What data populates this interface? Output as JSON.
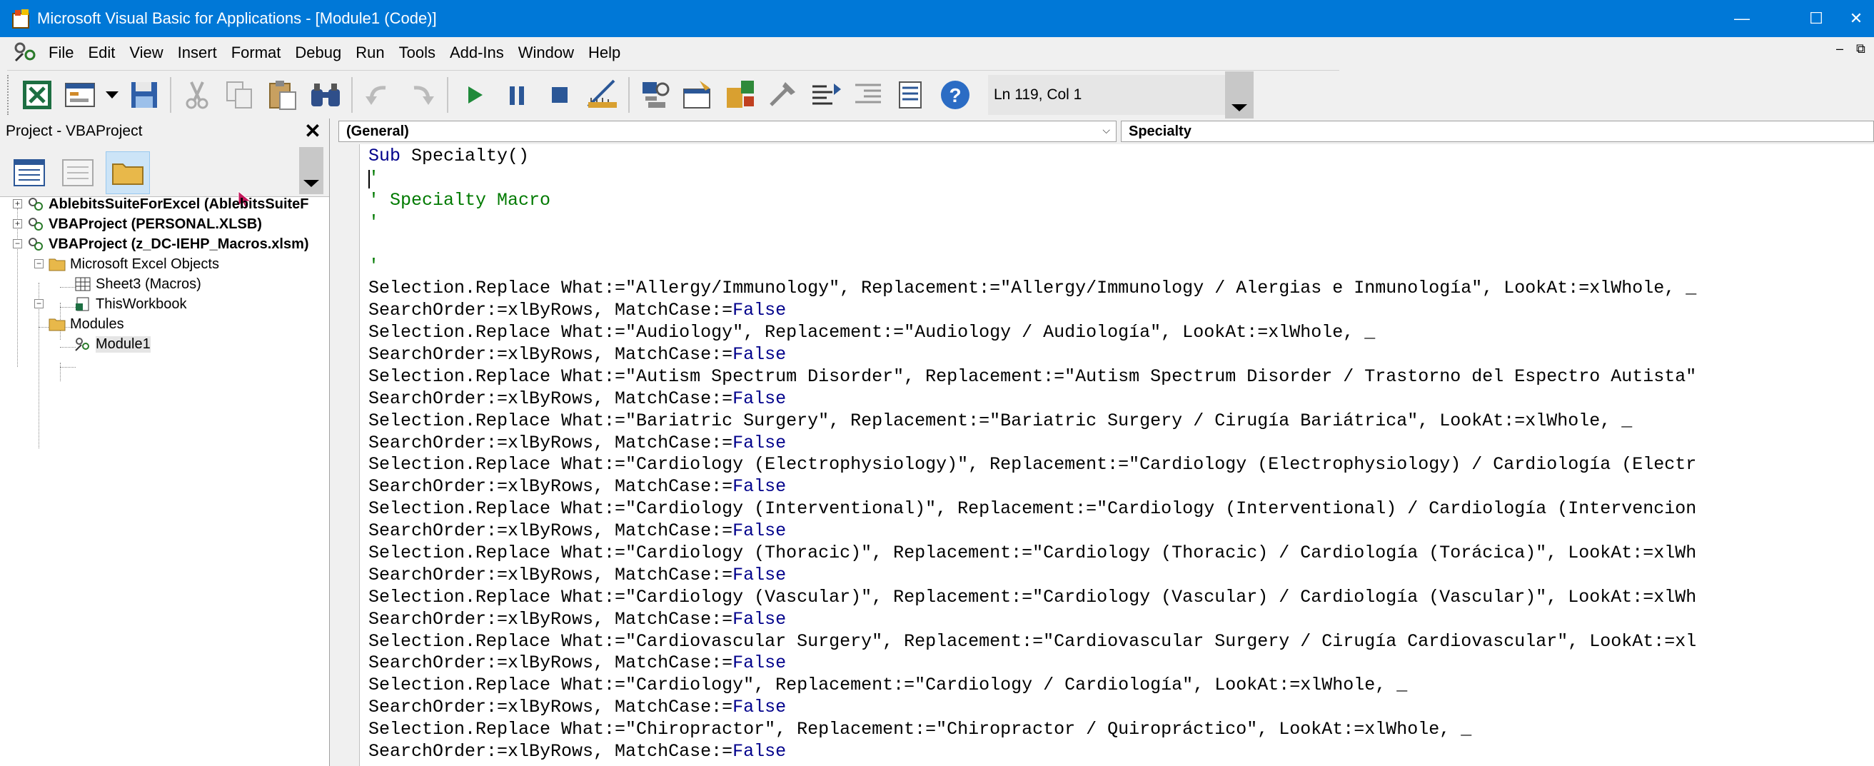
{
  "window": {
    "title": "Microsoft Visual Basic for Applications - [Module1 (Code)]",
    "controls": {
      "minimize": "—",
      "maximize": "☐",
      "close": "✕"
    }
  },
  "menu": {
    "items": [
      "File",
      "Edit",
      "View",
      "Insert",
      "Format",
      "Debug",
      "Run",
      "Tools",
      "Add-Ins",
      "Window",
      "Help"
    ],
    "mdi_min": "–",
    "mdi_restore": "⧉"
  },
  "toolbar": {
    "buttons": [
      "view-excel",
      "insert-userform",
      "insert-dropdown",
      "save",
      "cut",
      "copy",
      "paste",
      "find",
      "undo",
      "redo",
      "run",
      "break",
      "reset",
      "design-mode",
      "project-explorer",
      "properties-window",
      "object-browser",
      "toolbox",
      "tab-order",
      "indent",
      "outdent",
      "comment-block",
      "help"
    ],
    "position_text": "Ln 119, Col 1"
  },
  "project": {
    "title": "Project - VBAProject",
    "close": "✕",
    "tree": [
      {
        "label": "AblebitsSuiteForExcel (AblebitsSuiteF",
        "bold": true
      },
      {
        "label": "VBAProject (PERSONAL.XLSB)",
        "bold": true
      },
      {
        "label": "VBAProject (z_DC-IEHP_Macros.xlsm)",
        "bold": true
      },
      {
        "label": "Microsoft Excel Objects",
        "bold": false
      },
      {
        "label": "Sheet3 (Macros)",
        "bold": false
      },
      {
        "label": "ThisWorkbook",
        "bold": false
      },
      {
        "label": "Modules",
        "bold": false
      },
      {
        "label": "Module1",
        "bold": false
      }
    ]
  },
  "code": {
    "object_combo": "(General)",
    "proc_combo": "Specialty",
    "lines": [
      [
        {
          "t": "Sub ",
          "c": "kw"
        },
        {
          "t": "Specialty()",
          "c": ""
        }
      ],
      [
        {
          "t": "'",
          "c": "cm"
        }
      ],
      [
        {
          "t": "' Specialty Macro",
          "c": "cm"
        }
      ],
      [
        {
          "t": "'",
          "c": "cm"
        }
      ],
      [
        {
          "t": "",
          "c": ""
        }
      ],
      [
        {
          "t": "'",
          "c": "cm"
        }
      ],
      [
        {
          "t": "Selection.Replace What:=\"Allergy/Immunology\", Replacement:=\"Allergy/Immunology / Alergias e Inmunología\", LookAt:=xlWhole, _",
          "c": ""
        }
      ],
      [
        {
          "t": "SearchOrder:=xlByRows, MatchCase:=",
          "c": ""
        },
        {
          "t": "False",
          "c": "kw"
        }
      ],
      [
        {
          "t": "Selection.Replace What:=\"Audiology\", Replacement:=\"Audiology / Audiología\", LookAt:=xlWhole, _",
          "c": ""
        }
      ],
      [
        {
          "t": "SearchOrder:=xlByRows, MatchCase:=",
          "c": ""
        },
        {
          "t": "False",
          "c": "kw"
        }
      ],
      [
        {
          "t": "Selection.Replace What:=\"Autism Spectrum Disorder\", Replacement:=\"Autism Spectrum Disorder / Trastorno del Espectro Autista\"",
          "c": ""
        }
      ],
      [
        {
          "t": "SearchOrder:=xlByRows, MatchCase:=",
          "c": ""
        },
        {
          "t": "False",
          "c": "kw"
        }
      ],
      [
        {
          "t": "Selection.Replace What:=\"Bariatric Surgery\", Replacement:=\"Bariatric Surgery / Cirugía Bariátrica\", LookAt:=xlWhole, _",
          "c": ""
        }
      ],
      [
        {
          "t": "SearchOrder:=xlByRows, MatchCase:=",
          "c": ""
        },
        {
          "t": "False",
          "c": "kw"
        }
      ],
      [
        {
          "t": "Selection.Replace What:=\"Cardiology (Electrophysiology)\", Replacement:=\"Cardiology (Electrophysiology) / Cardiología (Electr",
          "c": ""
        }
      ],
      [
        {
          "t": "SearchOrder:=xlByRows, MatchCase:=",
          "c": ""
        },
        {
          "t": "False",
          "c": "kw"
        }
      ],
      [
        {
          "t": "Selection.Replace What:=\"Cardiology (Interventional)\", Replacement:=\"Cardiology (Interventional) / Cardiología (Intervencion",
          "c": ""
        }
      ],
      [
        {
          "t": "SearchOrder:=xlByRows, MatchCase:=",
          "c": ""
        },
        {
          "t": "False",
          "c": "kw"
        }
      ],
      [
        {
          "t": "Selection.Replace What:=\"Cardiology (Thoracic)\", Replacement:=\"Cardiology (Thoracic) / Cardiología (Torácica)\", LookAt:=xlWh",
          "c": ""
        }
      ],
      [
        {
          "t": "SearchOrder:=xlByRows, MatchCase:=",
          "c": ""
        },
        {
          "t": "False",
          "c": "kw"
        }
      ],
      [
        {
          "t": "Selection.Replace What:=\"Cardiology (Vascular)\", Replacement:=\"Cardiology (Vascular) / Cardiología (Vascular)\", LookAt:=xlWh",
          "c": ""
        }
      ],
      [
        {
          "t": "SearchOrder:=xlByRows, MatchCase:=",
          "c": ""
        },
        {
          "t": "False",
          "c": "kw"
        }
      ],
      [
        {
          "t": "Selection.Replace What:=\"Cardiovascular Surgery\", Replacement:=\"Cardiovascular Surgery / Cirugía Cardiovascular\", LookAt:=xl",
          "c": ""
        }
      ],
      [
        {
          "t": "SearchOrder:=xlByRows, MatchCase:=",
          "c": ""
        },
        {
          "t": "False",
          "c": "kw"
        }
      ],
      [
        {
          "t": "Selection.Replace What:=\"Cardiology\", Replacement:=\"Cardiology / Cardiología\", LookAt:=xlWhole, _",
          "c": ""
        }
      ],
      [
        {
          "t": "SearchOrder:=xlByRows, MatchCase:=",
          "c": ""
        },
        {
          "t": "False",
          "c": "kw"
        }
      ],
      [
        {
          "t": "Selection.Replace What:=\"Chiropractor\", Replacement:=\"Chiropractor / Quiropráctico\", LookAt:=xlWhole, _",
          "c": ""
        }
      ],
      [
        {
          "t": "SearchOrder:=xlByRows, MatchCase:=",
          "c": ""
        },
        {
          "t": "False",
          "c": "kw"
        }
      ]
    ]
  }
}
